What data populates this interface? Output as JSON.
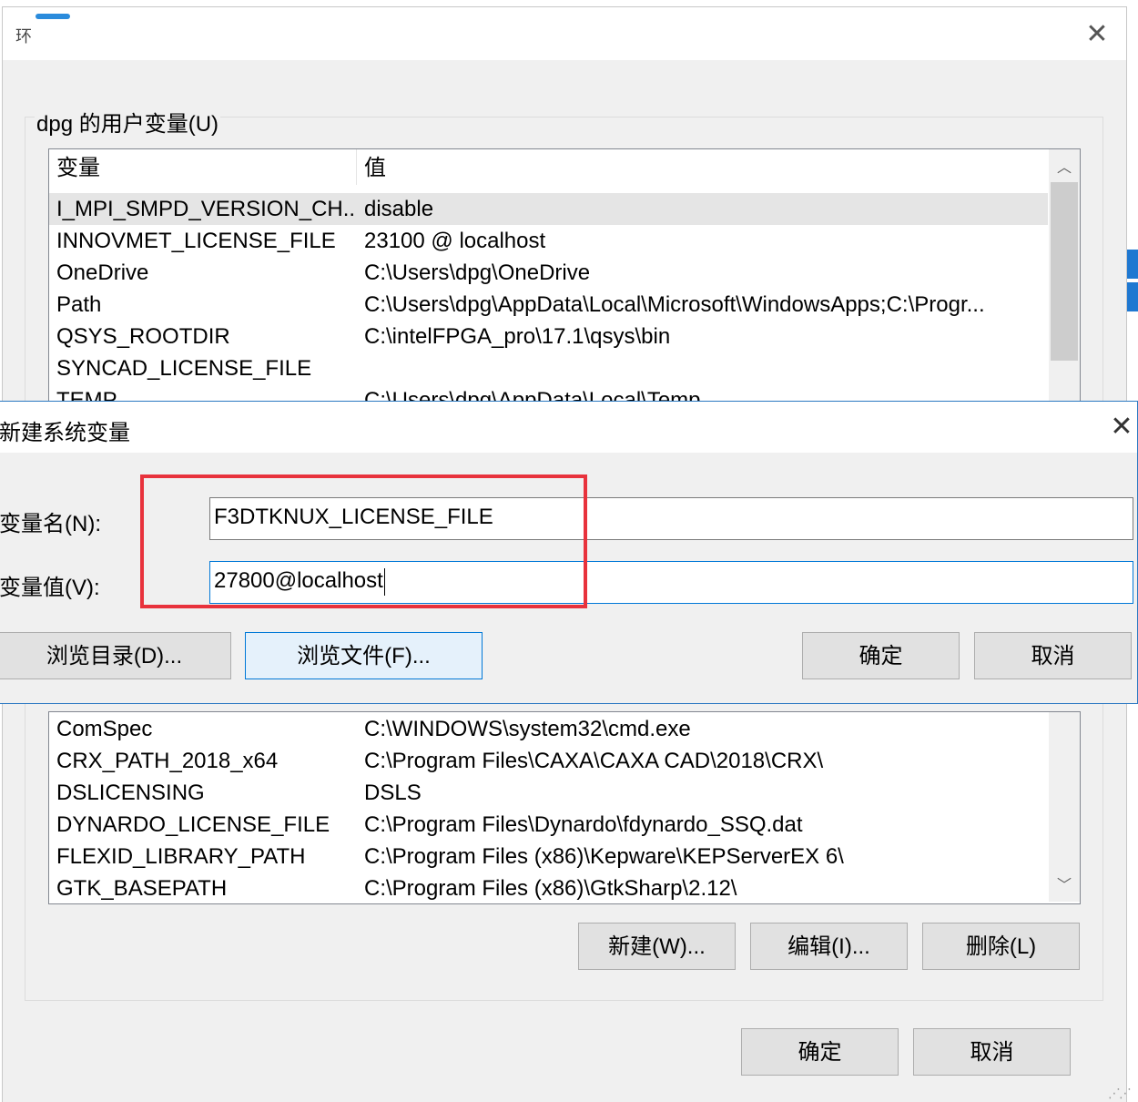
{
  "window": {
    "title_fragment": "环",
    "close_glyph": "✕"
  },
  "user_vars": {
    "group_label": "dpg 的用户变量(U)",
    "columns": [
      "变量",
      "值"
    ],
    "rows": [
      {
        "var": "I_MPI_SMPD_VERSION_CH...",
        "val": "disable",
        "selected": true
      },
      {
        "var": "INNOVMET_LICENSE_FILE",
        "val": "23100 @ localhost"
      },
      {
        "var": "OneDrive",
        "val": "C:\\Users\\dpg\\OneDrive"
      },
      {
        "var": "Path",
        "val": "C:\\Users\\dpg\\AppData\\Local\\Microsoft\\WindowsApps;C:\\Progr..."
      },
      {
        "var": "QSYS_ROOTDIR",
        "val": "C:\\intelFPGA_pro\\17.1\\qsys\\bin"
      },
      {
        "var": "SYNCAD_LICENSE_FILE",
        "val": ""
      },
      {
        "var": "TEMP",
        "val": "C:\\Users\\dpg\\AppData\\Local\\Temp"
      }
    ]
  },
  "system_vars": {
    "rows": [
      {
        "var": "ComSpec",
        "val": "C:\\WINDOWS\\system32\\cmd.exe"
      },
      {
        "var": "CRX_PATH_2018_x64",
        "val": "C:\\Program Files\\CAXA\\CAXA CAD\\2018\\CRX\\"
      },
      {
        "var": "DSLICENSING",
        "val": "DSLS"
      },
      {
        "var": "DYNARDO_LICENSE_FILE",
        "val": "C:\\Program Files\\Dynardo\\fdynardo_SSQ.dat"
      },
      {
        "var": "FLEXID_LIBRARY_PATH",
        "val": "C:\\Program Files (x86)\\Kepware\\KEPServerEX 6\\"
      },
      {
        "var": "GTK_BASEPATH",
        "val": "C:\\Program Files (x86)\\GtkSharp\\2.12\\"
      }
    ],
    "buttons": {
      "new": "新建(W)...",
      "edit": "编辑(I)...",
      "delete": "删除(L)"
    }
  },
  "main_buttons": {
    "ok": "确定",
    "cancel": "取消"
  },
  "dialog": {
    "title": "新建系统变量",
    "close_glyph": "✕",
    "name_label": "变量名(N):",
    "name_value": "F3DTKNUX_LICENSE_FILE",
    "value_label": "变量值(V):",
    "value_value": "27800@localhost",
    "buttons": {
      "browse_dir": "浏览目录(D)...",
      "browse_file": "浏览文件(F)...",
      "ok": "确定",
      "cancel": "取消"
    }
  },
  "colors": {
    "highlight": "#e8323c",
    "focus": "#0078d7",
    "dialog_border": "#2b79c2"
  }
}
